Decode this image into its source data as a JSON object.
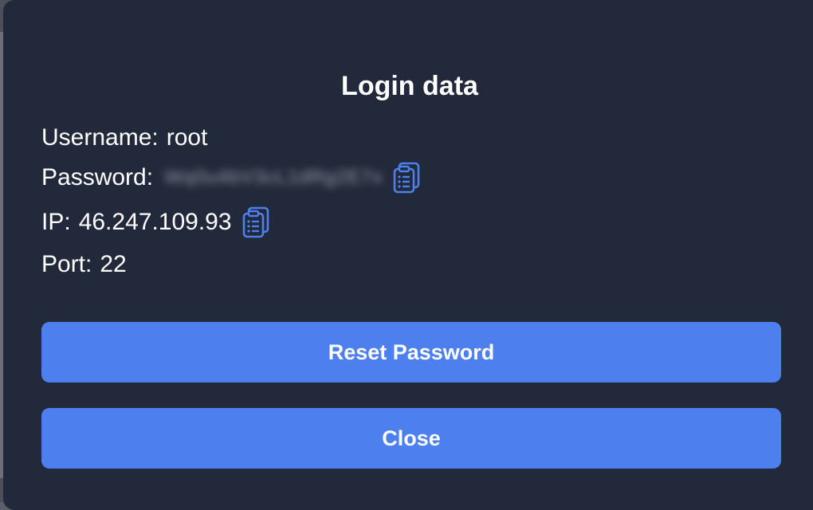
{
  "dialog": {
    "title": "Login data",
    "username_label": "Username:",
    "username_value": "root",
    "password_label": "Password:",
    "password_value": "Wq0u4bV3cL1dRg2E7x",
    "ip_label": "IP:",
    "ip_value": "46.247.109.93",
    "port_label": "Port:",
    "port_value": "22"
  },
  "buttons": {
    "reset_label": "Reset Password",
    "close_label": "Close"
  },
  "icons": {
    "copy_password": "clipboard-icon",
    "copy_ip": "clipboard-icon"
  },
  "colors": {
    "modal_bg": "#21293a",
    "button_bg": "#4d80ee",
    "icon": "#4d80ee",
    "text": "#ffffff"
  }
}
